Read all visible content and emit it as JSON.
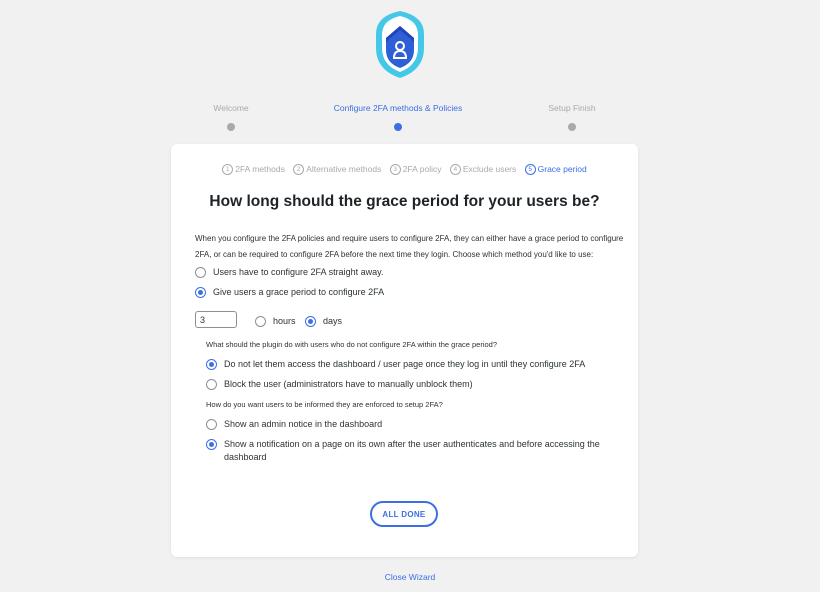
{
  "logo": {
    "icon": "shield-lock-icon",
    "colors": [
      "#3b6fe3",
      "#45c7e8"
    ]
  },
  "wizard_steps": [
    {
      "label": "Welcome",
      "active": false
    },
    {
      "label": "Configure 2FA methods & Policies",
      "active": true
    },
    {
      "label": "Setup Finish",
      "active": false
    }
  ],
  "substeps": [
    {
      "num": "1",
      "label": "2FA methods",
      "active": false
    },
    {
      "num": "2",
      "label": "Alternative methods",
      "active": false
    },
    {
      "num": "3",
      "label": "2FA policy",
      "active": false
    },
    {
      "num": "4",
      "label": "Exclude users",
      "active": false
    },
    {
      "num": "5",
      "label": "Grace period",
      "active": true
    }
  ],
  "title": "How long should the grace period for your users be?",
  "intro": "When you configure the 2FA policies and require users to configure 2FA, they can either have a grace period to configure 2FA, or can be required to configure 2FA before the next time they login. Choose which method you'd like to use:",
  "options": {
    "straight_away": "Users have to configure 2FA straight away.",
    "grace_period": "Give users a grace period to configure 2FA"
  },
  "grace": {
    "value": "3",
    "hours": "hours",
    "days": "days",
    "selected_unit": "days"
  },
  "question1": "What should the plugin do with users who do not configure 2FA within the grace period?",
  "q1_options": {
    "no_access": "Do not let them access the dashboard / user page once they log in until they configure 2FA",
    "block": "Block the user (administrators have to manually unblock them)"
  },
  "question2": "How do you want users to be informed they are enforced to setup 2FA?",
  "q2_options": {
    "admin_notice": "Show an admin notice in the dashboard",
    "notification_page": "Show a notification on a page on its own after the user authenticates and before accessing the dashboard"
  },
  "button": "ALL DONE",
  "close": "Close Wizard",
  "accent_color": "#3b6fe3"
}
